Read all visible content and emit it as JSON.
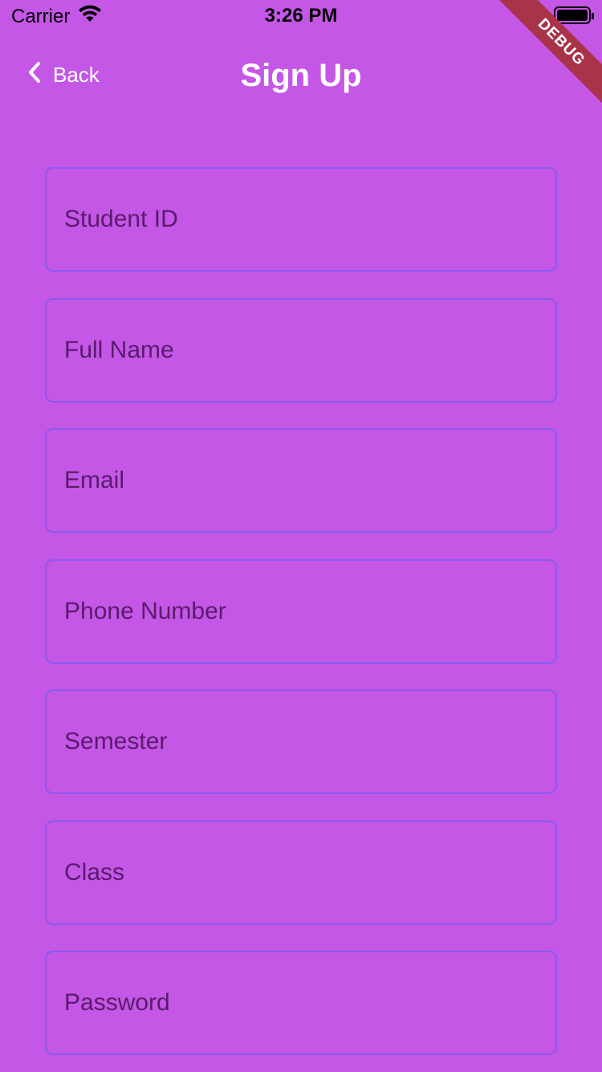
{
  "status_bar": {
    "carrier": "Carrier",
    "time": "3:26 PM",
    "wifi_icon": "wifi-icon",
    "battery_icon": "battery-icon"
  },
  "debug_banner": "DEBUG",
  "nav": {
    "back_label": "Back",
    "back_icon": "chevron-left-icon",
    "title": "Sign Up"
  },
  "form": {
    "fields": [
      {
        "placeholder": "Student ID"
      },
      {
        "placeholder": "Full Name"
      },
      {
        "placeholder": "Email"
      },
      {
        "placeholder": "Phone Number"
      },
      {
        "placeholder": "Semester"
      },
      {
        "placeholder": "Class"
      },
      {
        "placeholder": "Password"
      }
    ]
  },
  "colors": {
    "background": "#c457e5",
    "field_border": "#8b59ee",
    "placeholder_text": "#5a1a6e",
    "debug_ribbon": "#a9344a"
  }
}
